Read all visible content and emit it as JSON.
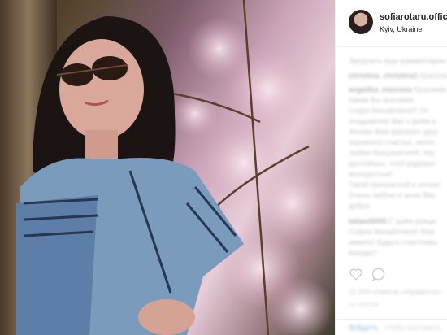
{
  "post": {
    "username": "sofiarotaru.official",
    "location": "Kyiv, Ukraine",
    "load_more": "Загрузить еще комментарии",
    "comments": [
      {
        "user": "christina_christina1",
        "text": "Красота"
      },
      {
        "user": "angelika_mavrova",
        "text": "Красивая"
      },
      {
        "user": "",
        "text": "Какая Вы красивая"
      },
      {
        "user": "",
        "text": "Софія Михайлівна!!! От"
      },
      {
        "user": "",
        "text": "поздравляю Вас з Днём р"
      },
      {
        "user": "",
        "text": "Желаю Вам крепкого здор"
      },
      {
        "user": "",
        "text": "огромного счастья, неско"
      },
      {
        "user": "",
        "text": "любви безграничной, пер"
      },
      {
        "user": "",
        "text": "достойных, чтоб радовал"
      },
      {
        "user": "",
        "text": "молодостью!"
      },
      {
        "user": "",
        "text": "Такой прекрасной и неповт"
      },
      {
        "user": "",
        "text": "Очень люблю и ценю Вас"
      },
      {
        "user": "",
        "text": "добра"
      },
      {
        "user": "tatiani5005",
        "text": "С днём рожде"
      },
      {
        "user": "",
        "text": "Софии Михайловне! Вам"
      },
      {
        "user": "",
        "text": "живите! Будьте счастливы"
      },
      {
        "user": "",
        "text": "всегда!!!"
      }
    ],
    "likes": "11 034 отметок «Нравится»",
    "time": "14 ЧАСОВ",
    "footer_link": "Войдите,",
    "footer_text": "чтобы поставить"
  },
  "colors": {
    "username": "#262626",
    "link": "#3897f0",
    "muted": "#c7c7c7"
  },
  "icons": [
    "heart-icon",
    "comment-icon"
  ]
}
